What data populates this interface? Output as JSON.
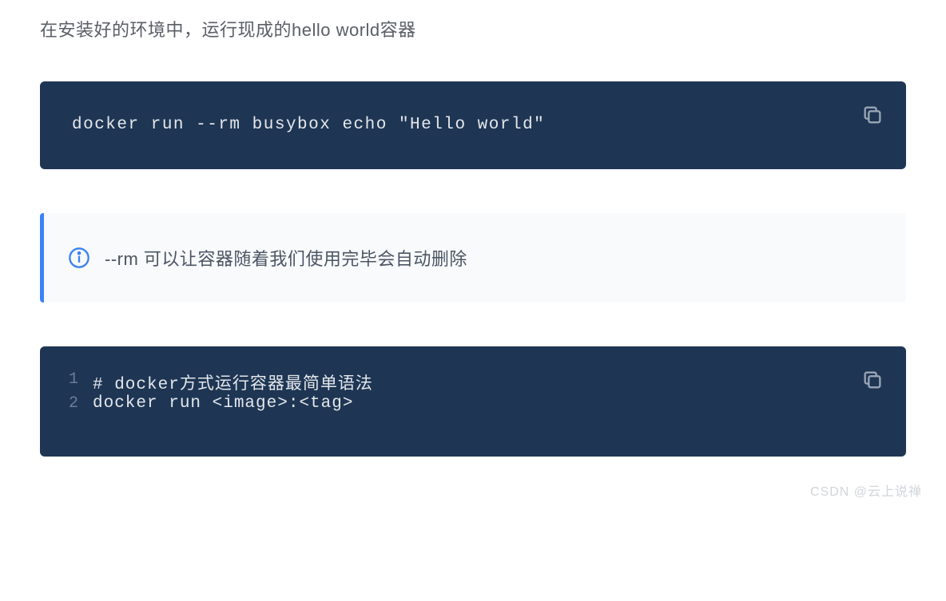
{
  "intro": "在安装好的环境中，运行现成的hello world容器",
  "code1": {
    "content": "docker run --rm busybox echo \"Hello world\""
  },
  "callout": {
    "text": "--rm 可以让容器随着我们使用完毕会自动删除"
  },
  "code2": {
    "lines": [
      {
        "num": "1",
        "text": "# docker方式运行容器最简单语法"
      },
      {
        "num": "2",
        "text": "docker run <image>:<tag>"
      }
    ]
  },
  "watermark": "CSDN @云上说禅"
}
